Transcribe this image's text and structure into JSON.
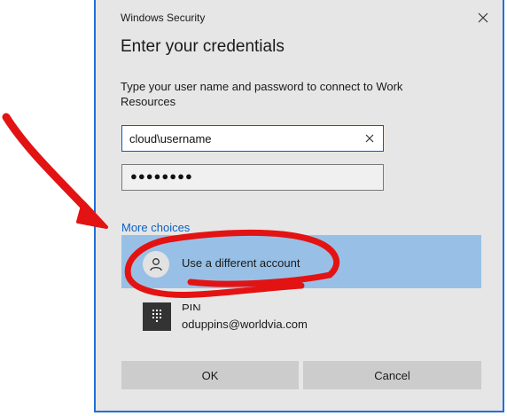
{
  "window": {
    "title": "Windows Security",
    "close_icon": "close-icon"
  },
  "dialog": {
    "heading": "Enter your credentials",
    "instructions": "Type your user name and password to connect to Work Resources"
  },
  "username": {
    "value": "cloud\\username",
    "clear_icon": "clear-x-icon"
  },
  "password": {
    "masked_value": "●●●●●●●●"
  },
  "more_choices": {
    "label": "More choices",
    "options": [
      {
        "label": "Use a different account",
        "icon": "user-icon",
        "selected": true
      },
      {
        "title": "PIN",
        "account": "oduppins@worldvia.com",
        "icon": "keypad-icon",
        "selected": false
      }
    ]
  },
  "buttons": {
    "ok": "OK",
    "cancel": "Cancel"
  },
  "colors": {
    "accent": "#0a62c6",
    "selection": "#98c0e6",
    "dialog_bg": "#e6e6e6",
    "annotation": "#e31313"
  }
}
